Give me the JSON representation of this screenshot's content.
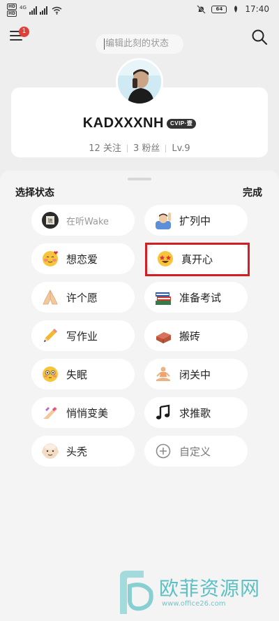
{
  "status_bar": {
    "hd_top": "HD",
    "hd_bottom": "HD",
    "network": "4G",
    "battery": "64",
    "time": "17:40"
  },
  "header": {
    "menu_badge": "1",
    "status_placeholder": "编辑此刻的状态",
    "icons": [
      "menu-icon",
      "search-icon"
    ]
  },
  "profile": {
    "username": "KADXXXNH",
    "vip_badge": "CVIP·壹",
    "follow": "12 关注",
    "fans": "3 粉丝",
    "level": "Lv.9"
  },
  "sheet": {
    "title": "选择状态",
    "done": "完成",
    "items": [
      {
        "label": "在听Wake",
        "icon": "music-cover-icon"
      },
      {
        "label": "扩列中",
        "icon": "raising-hand-icon"
      },
      {
        "label": "想恋爱",
        "icon": "smiling-hearts-icon"
      },
      {
        "label": "真开心",
        "icon": "star-struck-icon"
      },
      {
        "label": "许个愿",
        "icon": "folded-hands-icon"
      },
      {
        "label": "准备考试",
        "icon": "books-icon"
      },
      {
        "label": "写作业",
        "icon": "pencil-icon"
      },
      {
        "label": "搬砖",
        "icon": "brick-icon"
      },
      {
        "label": "失眠",
        "icon": "flushed-face-icon"
      },
      {
        "label": "闭关中",
        "icon": "meditation-icon"
      },
      {
        "label": "悄悄变美",
        "icon": "nail-polish-icon"
      },
      {
        "label": "求推歌",
        "icon": "music-note-icon"
      },
      {
        "label": "头秃",
        "icon": "bald-face-icon"
      },
      {
        "label": "自定义",
        "icon": "plus-circle-icon"
      }
    ]
  },
  "watermark": {
    "title": "欧菲资源网",
    "url": "www.office26.com"
  }
}
